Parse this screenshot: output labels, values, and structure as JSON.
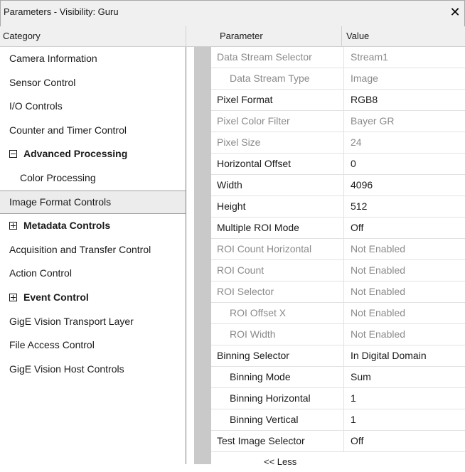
{
  "window": {
    "title": "Parameters - Visibility: Guru",
    "close_glyph": "✕"
  },
  "left": {
    "header": "Category",
    "items": [
      {
        "label": "Camera Information",
        "style": "normal"
      },
      {
        "label": "Sensor Control",
        "style": "normal"
      },
      {
        "label": "I/O Controls",
        "style": "normal"
      },
      {
        "label": "Counter and Timer Control",
        "style": "normal"
      },
      {
        "label": "Advanced Processing",
        "style": "expanded"
      },
      {
        "label": "Color Processing",
        "style": "sub"
      },
      {
        "label": "Image Format Controls",
        "style": "selected"
      },
      {
        "label": "Metadata Controls",
        "style": "collapsed"
      },
      {
        "label": "Acquisition and Transfer Control",
        "style": "normal"
      },
      {
        "label": "Action Control",
        "style": "normal"
      },
      {
        "label": "Event Control",
        "style": "collapsed"
      },
      {
        "label": "GigE Vision Transport Layer",
        "style": "normal"
      },
      {
        "label": "File Access Control",
        "style": "normal"
      },
      {
        "label": "GigE Vision Host Controls",
        "style": "normal"
      }
    ]
  },
  "grid": {
    "col_parameter": "Parameter",
    "col_value": "Value",
    "rows": [
      {
        "param": "Data Stream Selector",
        "value": "Stream1",
        "dim": true,
        "indent": 0
      },
      {
        "param": "Data Stream Type",
        "value": "Image",
        "dim": true,
        "indent": 1
      },
      {
        "param": "Pixel Format",
        "value": "RGB8",
        "dim": false,
        "indent": 0
      },
      {
        "param": "Pixel Color Filter",
        "value": "Bayer GR",
        "dim": true,
        "indent": 0
      },
      {
        "param": "Pixel Size",
        "value": "24",
        "dim": true,
        "indent": 0
      },
      {
        "param": "Horizontal Offset",
        "value": "0",
        "dim": false,
        "indent": 0
      },
      {
        "param": "Width",
        "value": "4096",
        "dim": false,
        "indent": 0
      },
      {
        "param": "Height",
        "value": "512",
        "dim": false,
        "indent": 0
      },
      {
        "param": "Multiple ROI Mode",
        "value": "Off",
        "dim": false,
        "indent": 0
      },
      {
        "param": "ROI Count Horizontal",
        "value": "Not Enabled",
        "dim": true,
        "indent": 0
      },
      {
        "param": "ROI Count",
        "value": "Not Enabled",
        "dim": true,
        "indent": 0
      },
      {
        "param": "ROI Selector",
        "value": "Not Enabled",
        "dim": true,
        "indent": 0
      },
      {
        "param": "ROI Offset X",
        "value": "Not Enabled",
        "dim": true,
        "indent": 1
      },
      {
        "param": "ROI Width",
        "value": "Not Enabled",
        "dim": true,
        "indent": 1
      },
      {
        "param": "Binning Selector",
        "value": "In Digital Domain",
        "dim": false,
        "indent": 0
      },
      {
        "param": "Binning Mode",
        "value": "Sum",
        "dim": false,
        "indent": 1
      },
      {
        "param": "Binning Horizontal",
        "value": "1",
        "dim": false,
        "indent": 1
      },
      {
        "param": "Binning Vertical",
        "value": "1",
        "dim": false,
        "indent": 1
      },
      {
        "param": "Test Image Selector",
        "value": "Off",
        "dim": false,
        "indent": 0
      }
    ],
    "less_label": "<< Less"
  }
}
